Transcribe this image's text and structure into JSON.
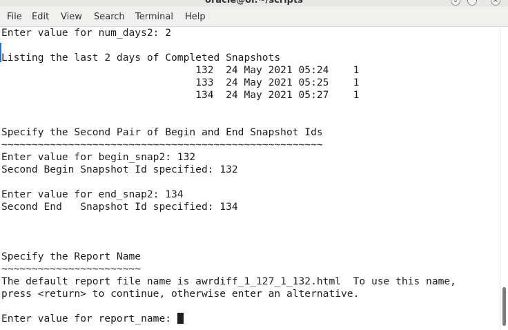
{
  "window": {
    "title": "oracle@ol:~/scripts",
    "controls": {
      "minimize_glyph": "⌄",
      "close_glyph": "×"
    }
  },
  "menu": {
    "file": "File",
    "edit": "Edit",
    "view": "View",
    "search": "Search",
    "terminal": "Terminal",
    "help": "Help"
  },
  "terminal": {
    "lines": [
      "Enter value for num_days2: 2",
      "",
      "Listing the last 2 days of Completed Snapshots",
      "                                132  24 May 2021 05:24    1",
      "                                133  24 May 2021 05:25    1",
      "                                134  24 May 2021 05:27    1",
      "",
      "",
      "Specify the Second Pair of Begin and End Snapshot Ids",
      "~~~~~~~~~~~~~~~~~~~~~~~~~~~~~~~~~~~~~~~~~~~~~~~~~~~~~",
      "Enter value for begin_snap2: 132",
      "Second Begin Snapshot Id specified: 132",
      "",
      "Enter value for end_snap2: 134",
      "Second End   Snapshot Id specified: 134",
      "",
      "",
      "",
      "Specify the Report Name",
      "~~~~~~~~~~~~~~~~~~~~~~~",
      "The default report file name is awrdiff_1_127_1_132.html  To use this name,",
      "press <return> to continue, otherwise enter an alternative.",
      "",
      "Enter value for report_name: "
    ]
  }
}
